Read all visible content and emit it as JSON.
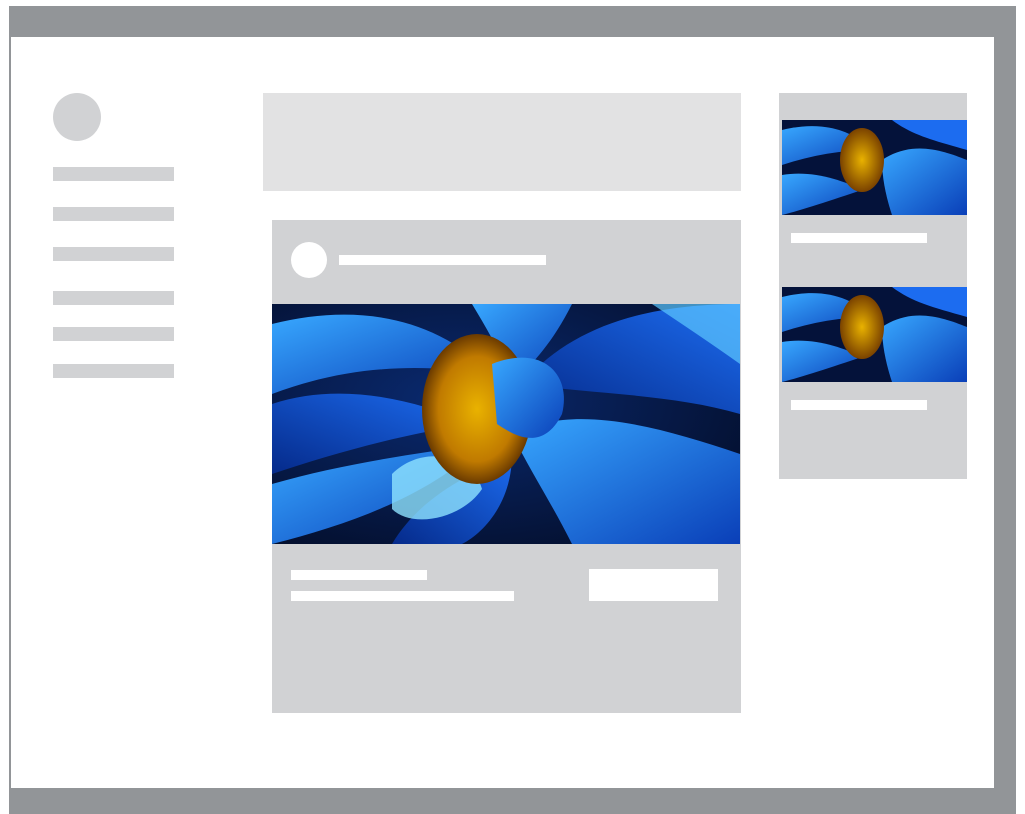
{
  "colors": {
    "frame": "#929598",
    "canvas": "#ffffff",
    "placeholder": "#d1d2d4",
    "banner": "#e2e2e3",
    "placeholder_light": "#ffffff"
  },
  "sidebar": {
    "nav_items": [
      "",
      "",
      "",
      "",
      "",
      ""
    ]
  },
  "main": {
    "banner_text": "",
    "post": {
      "author": "",
      "image": "blue-flower-photo",
      "title": "",
      "body": "",
      "action_label": ""
    }
  },
  "rail": {
    "cards": [
      {
        "image": "blue-flower-photo",
        "caption": ""
      },
      {
        "image": "blue-flower-photo",
        "caption": ""
      }
    ]
  }
}
